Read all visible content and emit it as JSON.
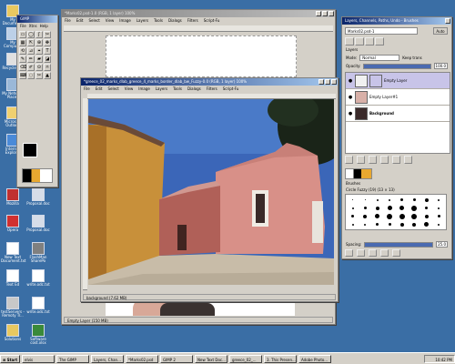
{
  "desktop": {
    "icons": [
      {
        "label": "My Documents"
      },
      {
        "label": "My Computer"
      },
      {
        "label": "Recycle Bin"
      },
      {
        "label": "My Network Places"
      },
      {
        "label": "Microsoft Outlook"
      },
      {
        "label": "Internet Explorer"
      },
      {
        "label": "Mozilla"
      },
      {
        "label": "Proposal.doc"
      },
      {
        "label": "Opera"
      },
      {
        "label": "Proposal.doc"
      },
      {
        "label": "New Text Document.txt"
      },
      {
        "label": "FlashMan SharePo"
      },
      {
        "label": "Text Ed"
      },
      {
        "label": "write.odc.txt"
      },
      {
        "label": "testServers - Remoty Tr..."
      },
      {
        "label": "write.odc.txt"
      },
      {
        "label": "Solutions"
      },
      {
        "label": "Software cost.xlsx"
      }
    ]
  },
  "toolbox": {
    "title": "GIMP",
    "menu": [
      "File",
      "Xtns",
      "Help"
    ],
    "tools": [
      "▭",
      "◯",
      "ʃ",
      "✂",
      "▦",
      "⇱",
      "⊕",
      "✥",
      "⟲",
      "⊿",
      "⌖",
      "T",
      "✎",
      "✏",
      "▰",
      "◪",
      "⌫",
      "✐",
      "⊙",
      "☼",
      "⌨",
      "◌",
      "✂",
      "▲"
    ]
  },
  "back_window": {
    "title": "*Marks02.psd-1.0 (RGB, 1 layer) 100%",
    "menu": [
      "File",
      "Edit",
      "Select",
      "View",
      "Image",
      "Layers",
      "Tools",
      "Dialogs",
      "Filters",
      "Script-Fu"
    ],
    "status": "Empty Layer (150 MB)"
  },
  "image_window": {
    "title": "*greece_02_marks_dlab_greece_4_marks_border_dlab_bw_Fuzzy-0.0 (RGB, 1 layer) 100%",
    "menu": [
      "File",
      "Edit",
      "Select",
      "View",
      "Image",
      "Layers",
      "Tools",
      "Dialogs",
      "Filters",
      "Script-Fu"
    ],
    "status": "background (7.62 MB)"
  },
  "layers_dialog": {
    "title": "Layers, Channels, Paths, Undo - Brushes",
    "image_select": "Marks02.psd-1",
    "auto_label": "Auto",
    "section_label": "Layers",
    "mode_label": "Mode:",
    "mode_value": "Normal",
    "keep_label": "Keep trans",
    "opacity_label": "Opacity:",
    "opacity_value": "100.0",
    "layers": [
      {
        "name": "Empty Layer"
      },
      {
        "name": "Empty Layer#1"
      },
      {
        "name": "Background"
      }
    ]
  },
  "brushes_dialog": {
    "section_label": "Brushes",
    "brush_name": "Circle Fuzzy (19) (13 × 13)",
    "spacing_label": "Spacing:",
    "spacing_value": "25.0"
  },
  "taskbar": {
    "start_label": "Start",
    "items": [
      "elvis",
      "The GIMP",
      "Layers, Chan...",
      "*Marks02.psd",
      "GIMP 2",
      "New Text Doc...",
      "greece_02_...",
      "3. This Presen...",
      "Adobe Photo..."
    ],
    "clock": "10:42 PM"
  },
  "colors": {
    "desktop": "#3a6ea5",
    "titlebar": "#0a246a",
    "window": "#d4d0c8"
  }
}
